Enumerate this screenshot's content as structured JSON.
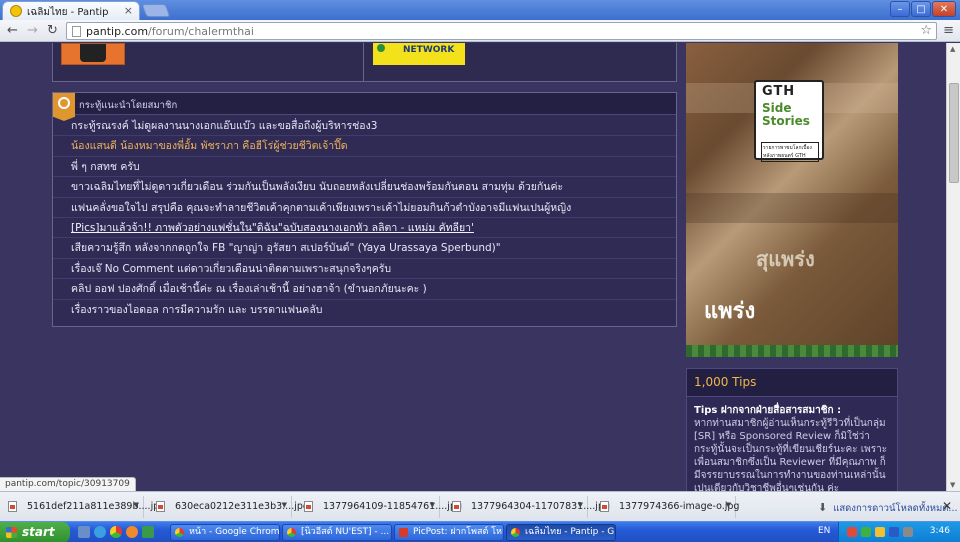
{
  "browser": {
    "tab_title": "เฉลิมไทย - Pantip",
    "tab_close": "×",
    "window_buttons": {
      "minimize": "–",
      "maximize": "□",
      "close": "✕"
    },
    "url_host": "pantip.com",
    "url_path": "/forum/chalermthai",
    "star": "☆",
    "menu": "≡",
    "back": "←",
    "forward": "→",
    "reload": "↻"
  },
  "top_images": {
    "right_label": "NETWORK"
  },
  "recommended": {
    "title": "กระทู้แนะนำโดยสมาชิก",
    "items": [
      {
        "text": "กระทู้รณรงค์ ไม่ดูผลงานนางเอกแอ๊บแบ๊ว และขอสื่อถึงผู้บริหารช่อง3",
        "style": "normal"
      },
      {
        "text": "น้องแสนดี น้องหมาของพี่อั้ม พัชราภา คือฮีโร่ผู้ช่วยชีวิตเจ้าปี๊ด",
        "style": "orange"
      },
      {
        "text": "พี่ ๆ กสทช ครับ",
        "style": "normal"
      },
      {
        "text": "ขาวเฉลิมไทยที่ไม่ดูดาวเกี่ยวเดือน ร่วมกันเป็นพลังเงียบ นับถอยหลังเปลี่ยนช่องพร้อมกันตอน สามทุ่ม ด้วยกันค่ะ",
        "style": "normal"
      },
      {
        "text": "แฟนคลั่งขอใจไป สรุปคือ คุณจะทำลายชีวิตเค้าคุกตามเค้าเพียงเพราะเค้าไม่ยอมกินก้วตำบังอาจมีแฟนเปนผู้หญิง",
        "style": "normal"
      },
      {
        "text": "[Pics]มาแล้วจ้า!! ภาพตัวอย่างแฟชั่นใน\"ดิฉัน\"ฉบับสองนางเอกหัว ลลิตา - แหม่ม คัทลียา'",
        "style": "under"
      },
      {
        "text": "เสียความรู้สึก หลังจากกดถูกใจ FB \"ญาญ่า อุรัสยา สเปอร์บันด์\" (Yaya Urassaya Sperbund)\"",
        "style": "normal"
      },
      {
        "text": "เรื่องเจ๊ No Comment แต่ดาวเกี่ยวเดือนน่าติดตามเพราะสนุกจริงๆครับ",
        "style": "normal"
      },
      {
        "text": "คลิป ออฟ ปองศักดิ์ เมื่อเช้านี้ค่ะ ณ เรื่องเล่าเช้านี้ อย่างฮาจ้า (ขำนอกภัยนะคะ )",
        "style": "normal"
      },
      {
        "text": "เรื่องราวของไอดอล การมีความรัก และ บรรดาแฟนคลับ",
        "style": "normal"
      }
    ]
  },
  "ad": {
    "logo_top": "GTH",
    "logo_mid1": "Side",
    "logo_mid2": "Stories",
    "logo_sub": "รายการพาชมโลกเบื้องหลังภาพยนตร์ GTH",
    "thai1": "สุแพร่ง",
    "thai2": "แพร่ง"
  },
  "tips": {
    "title": "1,000 Tips",
    "heading": "Tips ฝากจากฝ่ายสื่อสารสมาชิก :",
    "body": "หากท่านสมาชิกผู้อ่านเห็นกระทู้รีวิวที่เป็นกลุ่ม [SR] หรือ Sponsored Review ก็มิใช่ว่ากระทู้นั้นจะเป็นกระทู้ที่เขียนเชียร์นะคะ เพราะเพื่อนสมาชิกซึ่งเป็น Reviewer ที่มีคุณภาพ ก็มีจรรยาบรรณในการทำงานของท่านเหล่านั้นเปนเดียวกับวิชาชีพอื่นๆเช่นกัน ค่ะ"
  },
  "status_url": "pantip.com/topic/30913709",
  "downloads": {
    "items": [
      {
        "name": "5161def211a811e389b....jpg"
      },
      {
        "name": "630eca0212e311e3b3....jpg"
      },
      {
        "name": "1377964109-11854761....jpg"
      },
      {
        "name": "1377964304-11707831....jpg"
      },
      {
        "name": "1377974366-image-o.jpg"
      }
    ],
    "show_all": "แสดงการดาวน์โหลดทั้งหมด...",
    "close": "✕"
  },
  "taskbar": {
    "start": "start",
    "tasks": [
      {
        "label": "หน้า - Google Chrome",
        "icon": "chrome",
        "active": false
      },
      {
        "label": "[นิวอีสต์ NU'EST] - ...",
        "icon": "chrome",
        "active": false
      },
      {
        "label": "PicPost: ฝากโพสต์ โหลดรูป...",
        "icon": "picpost",
        "active": false
      },
      {
        "label": "เฉลิมไทย - Pantip - G...",
        "icon": "chrome",
        "active": true
      }
    ],
    "lang": "EN",
    "clock": "3:46"
  }
}
